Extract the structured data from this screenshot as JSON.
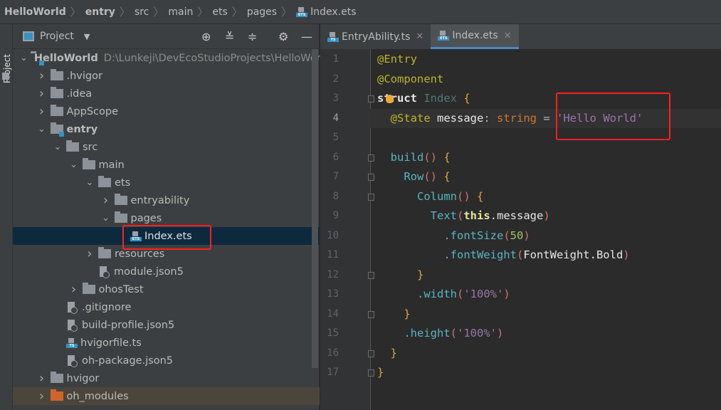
{
  "breadcrumb": [
    "HelloWorld",
    "entry",
    "src",
    "main",
    "ets",
    "pages",
    "Index.ets"
  ],
  "side_stripe": {
    "label": "Project"
  },
  "project_panel": {
    "title": "Project",
    "tools": [
      "locate-icon",
      "expand-all-icon",
      "collapse-all-icon",
      "gear-icon",
      "minimize-icon"
    ],
    "tree": [
      {
        "label": "HelloWorld",
        "path": "D:\\Lunkeji\\DevEcoStudioProjects\\HelloWorld",
        "depth": 0,
        "type": "module",
        "expanded": true,
        "bold": true
      },
      {
        "label": ".hvigor",
        "depth": 1,
        "type": "folder",
        "expanded": false
      },
      {
        "label": ".idea",
        "depth": 1,
        "type": "folder",
        "expanded": false
      },
      {
        "label": "AppScope",
        "depth": 1,
        "type": "folder",
        "expanded": false
      },
      {
        "label": "entry",
        "depth": 1,
        "type": "module",
        "expanded": true,
        "bold": true
      },
      {
        "label": "src",
        "depth": 2,
        "type": "folder",
        "expanded": true
      },
      {
        "label": "main",
        "depth": 3,
        "type": "folder",
        "expanded": true
      },
      {
        "label": "ets",
        "depth": 4,
        "type": "folder",
        "expanded": true
      },
      {
        "label": "entryability",
        "depth": 5,
        "type": "folder",
        "expanded": false
      },
      {
        "label": "pages",
        "depth": 5,
        "type": "folder",
        "expanded": true
      },
      {
        "label": "Index.ets",
        "depth": 6,
        "type": "ets",
        "selected": true
      },
      {
        "label": "resources",
        "depth": 4,
        "type": "folder",
        "expanded": false
      },
      {
        "label": "module.json5",
        "depth": 4,
        "type": "json"
      },
      {
        "label": "ohosTest",
        "depth": 3,
        "type": "folder",
        "expanded": false
      },
      {
        "label": ".gitignore",
        "depth": 2,
        "type": "json"
      },
      {
        "label": "build-profile.json5",
        "depth": 2,
        "type": "json"
      },
      {
        "label": "hvigorfile.ts",
        "depth": 2,
        "type": "ts"
      },
      {
        "label": "oh-package.json5",
        "depth": 2,
        "type": "json"
      },
      {
        "label": "hvigor",
        "depth": 1,
        "type": "folder",
        "expanded": false
      },
      {
        "label": "oh_modules",
        "depth": 1,
        "type": "folder-orange",
        "expanded": false,
        "highlighted": true
      }
    ]
  },
  "tabs": [
    {
      "label": "EntryAbility.ts",
      "icon": "ts",
      "active": false
    },
    {
      "label": "Index.ets",
      "icon": "ets",
      "active": true
    }
  ],
  "editor": {
    "current_line": 4,
    "lines": [
      [
        [
          "@Entry",
          "ann"
        ]
      ],
      [
        [
          "@Component",
          "ann"
        ]
      ],
      [
        [
          "struct ",
          "kw2"
        ],
        [
          "Index ",
          "cls"
        ],
        [
          "{",
          "br"
        ]
      ],
      [
        [
          "  @State ",
          "ann"
        ],
        [
          "message",
          "id"
        ],
        [
          ": ",
          "pl"
        ],
        [
          "string",
          "type"
        ],
        [
          " = ",
          "pl"
        ],
        [
          "'Hello World'",
          "str"
        ]
      ],
      [],
      [
        [
          "  build",
          "fn"
        ],
        [
          "()",
          "par"
        ],
        [
          " {",
          "br"
        ]
      ],
      [
        [
          "    Row",
          "fn"
        ],
        [
          "()",
          "par"
        ],
        [
          " {",
          "br"
        ]
      ],
      [
        [
          "      Column",
          "fn"
        ],
        [
          "()",
          "par"
        ],
        [
          " {",
          "br"
        ]
      ],
      [
        [
          "        Text",
          "fn"
        ],
        [
          "(",
          "par"
        ],
        [
          "this",
          "this"
        ],
        [
          ".message",
          "id"
        ],
        [
          ")",
          "par"
        ]
      ],
      [
        [
          "          .fontSize",
          "fn"
        ],
        [
          "(",
          "par"
        ],
        [
          "50",
          "num"
        ],
        [
          ")",
          "par"
        ]
      ],
      [
        [
          "          .fontWeight",
          "fn"
        ],
        [
          "(",
          "par"
        ],
        [
          "FontWeight.Bold",
          "id"
        ],
        [
          ")",
          "par"
        ]
      ],
      [
        [
          "      }",
          "br"
        ]
      ],
      [
        [
          "      .width",
          "fn"
        ],
        [
          "(",
          "par"
        ],
        [
          "'100%'",
          "str"
        ],
        [
          ")",
          "par"
        ]
      ],
      [
        [
          "    }",
          "br"
        ]
      ],
      [
        [
          "    .height",
          "fn"
        ],
        [
          "(",
          "par"
        ],
        [
          "'100%'",
          "str"
        ],
        [
          ")",
          "par"
        ]
      ],
      [
        [
          "  }",
          "br"
        ]
      ],
      [
        [
          "}",
          "br"
        ]
      ]
    ],
    "fold_lines": [
      3,
      6,
      7,
      8,
      12,
      14,
      16,
      17
    ]
  },
  "annotations": {
    "color": "#ff2020"
  }
}
